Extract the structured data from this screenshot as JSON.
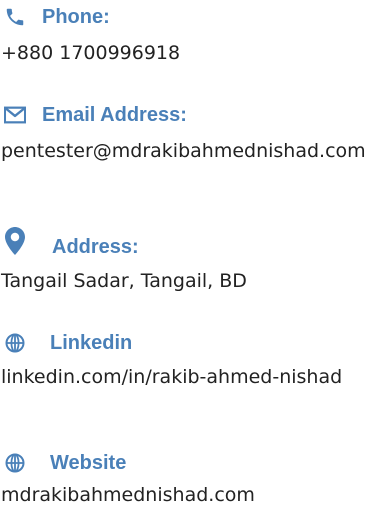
{
  "accent_color": "#4a80b8",
  "contacts": [
    {
      "icon": "phone-icon",
      "label": "Phone:",
      "value": "+880 1700996918"
    },
    {
      "icon": "envelope-icon",
      "label": "Email Address:",
      "value": "pentester@mdrakibahmednishad.com"
    },
    {
      "icon": "map-marker-icon",
      "label": "Address:",
      "value": "Tangail Sadar, Tangail, BD"
    },
    {
      "icon": "globe-icon",
      "label": "Linkedin",
      "value": "linkedin.com/in/rakib-ahmed-nishad"
    },
    {
      "icon": "globe-icon",
      "label": "Website",
      "value": "mdrakibahmednishad.com"
    }
  ]
}
